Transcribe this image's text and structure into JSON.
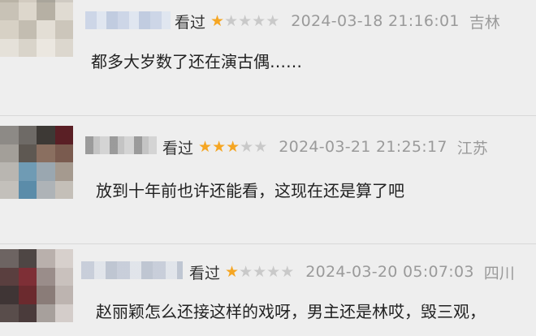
{
  "comments": [
    {
      "status": "看过",
      "rating": 1,
      "max_rating": 5,
      "time": "2024-03-18 21:16:01",
      "location": "吉林",
      "text": "都多大岁数了还在演古偶……"
    },
    {
      "status": "看过",
      "rating": 3,
      "max_rating": 5,
      "time": "2024-03-21 21:25:17",
      "location": "江苏",
      "text": "放到十年前也许还能看，这现在还是算了吧"
    },
    {
      "status": "看过",
      "rating": 1,
      "max_rating": 5,
      "time": "2024-03-20 05:07:03",
      "location": "四川",
      "text": "赵丽颖怎么还接这样的戏呀，男主还是林哎，毁三观，"
    }
  ],
  "colors": {
    "star_on": "#f5a623",
    "star_off": "#c9c9c9",
    "timestamp": "#9a9a9a",
    "background": "#eeeeee"
  }
}
